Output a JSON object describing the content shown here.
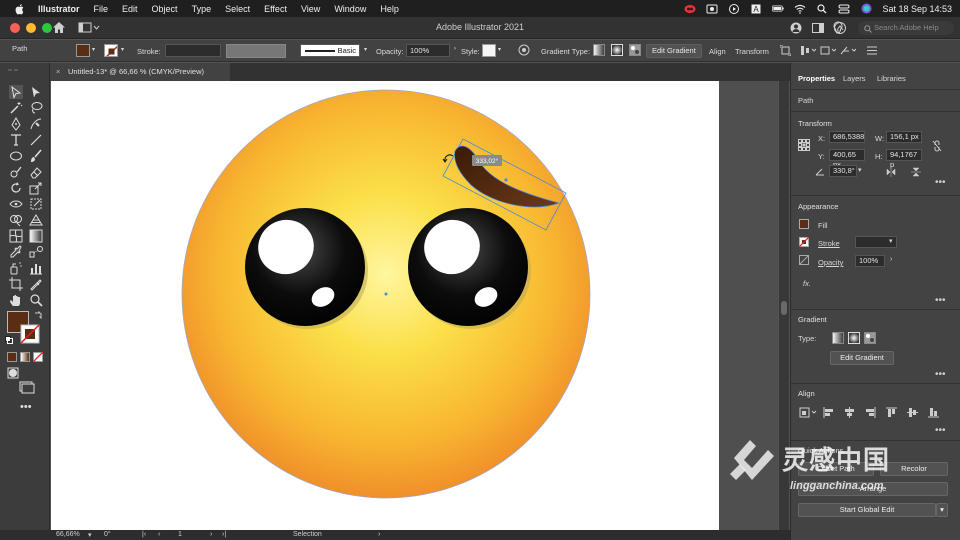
{
  "menubar": {
    "app_name": "Illustrator",
    "items": [
      "File",
      "Edit",
      "Object",
      "Type",
      "Select",
      "Effect",
      "View",
      "Window",
      "Help"
    ],
    "clock": "Sat 18 Sep  14:53"
  },
  "appbar": {
    "title": "Adobe Illustrator 2021",
    "search_placeholder": "Search Adobe Help"
  },
  "control_bar": {
    "selection_type": "Path",
    "stroke_label": "Stroke:",
    "brush_label": "Basic",
    "opacity_label": "Opacity:",
    "opacity_value": "100%",
    "style_label": "Style:",
    "gradient_type_label": "Gradient Type:",
    "edit_gradient": "Edit Gradient",
    "align": "Align",
    "transform": "Transform"
  },
  "document_tab": {
    "close": "×",
    "label": "Untitled-13* @ 66,66 % (CMYK/Preview)"
  },
  "canvas": {
    "rotation_tooltip": "333,02°"
  },
  "status_bar": {
    "zoom": "66,66%",
    "rotation": "0°",
    "artboard_number": "1",
    "tool": "Selection"
  },
  "panel": {
    "tabs": [
      "Properties",
      "Layers",
      "Libraries"
    ],
    "selection": "Path",
    "transform": {
      "heading": "Transform",
      "x_label": "X:",
      "x": "686,5388",
      "y_label": "Y:",
      "y": "400,65 px",
      "w_label": "W:",
      "w": "156,1 px",
      "h_label": "H:",
      "h": "94,1767 p",
      "angle": "330,8°"
    },
    "appearance": {
      "heading": "Appearance",
      "fill": "Fill",
      "stroke": "Stroke",
      "opacity": "Opacity",
      "opacity_value": "100%",
      "fx": "fx."
    },
    "gradient": {
      "heading": "Gradient",
      "type_label": "Type:",
      "edit_button": "Edit Gradient"
    },
    "align": {
      "heading": "Align"
    },
    "quick_actions": {
      "heading": "Quick Actions",
      "offset_path": "Offset Path",
      "recolor": "Recolor",
      "arrange": "Arrange",
      "start_global_edit": "Start Global Edit"
    }
  },
  "watermark": {
    "title": "灵感中国",
    "url": "lingganchina.com"
  },
  "colors": {
    "fill": "#5a2e12",
    "emoji_center": "#fff6a0",
    "emoji_edge": "#f08f2a"
  }
}
